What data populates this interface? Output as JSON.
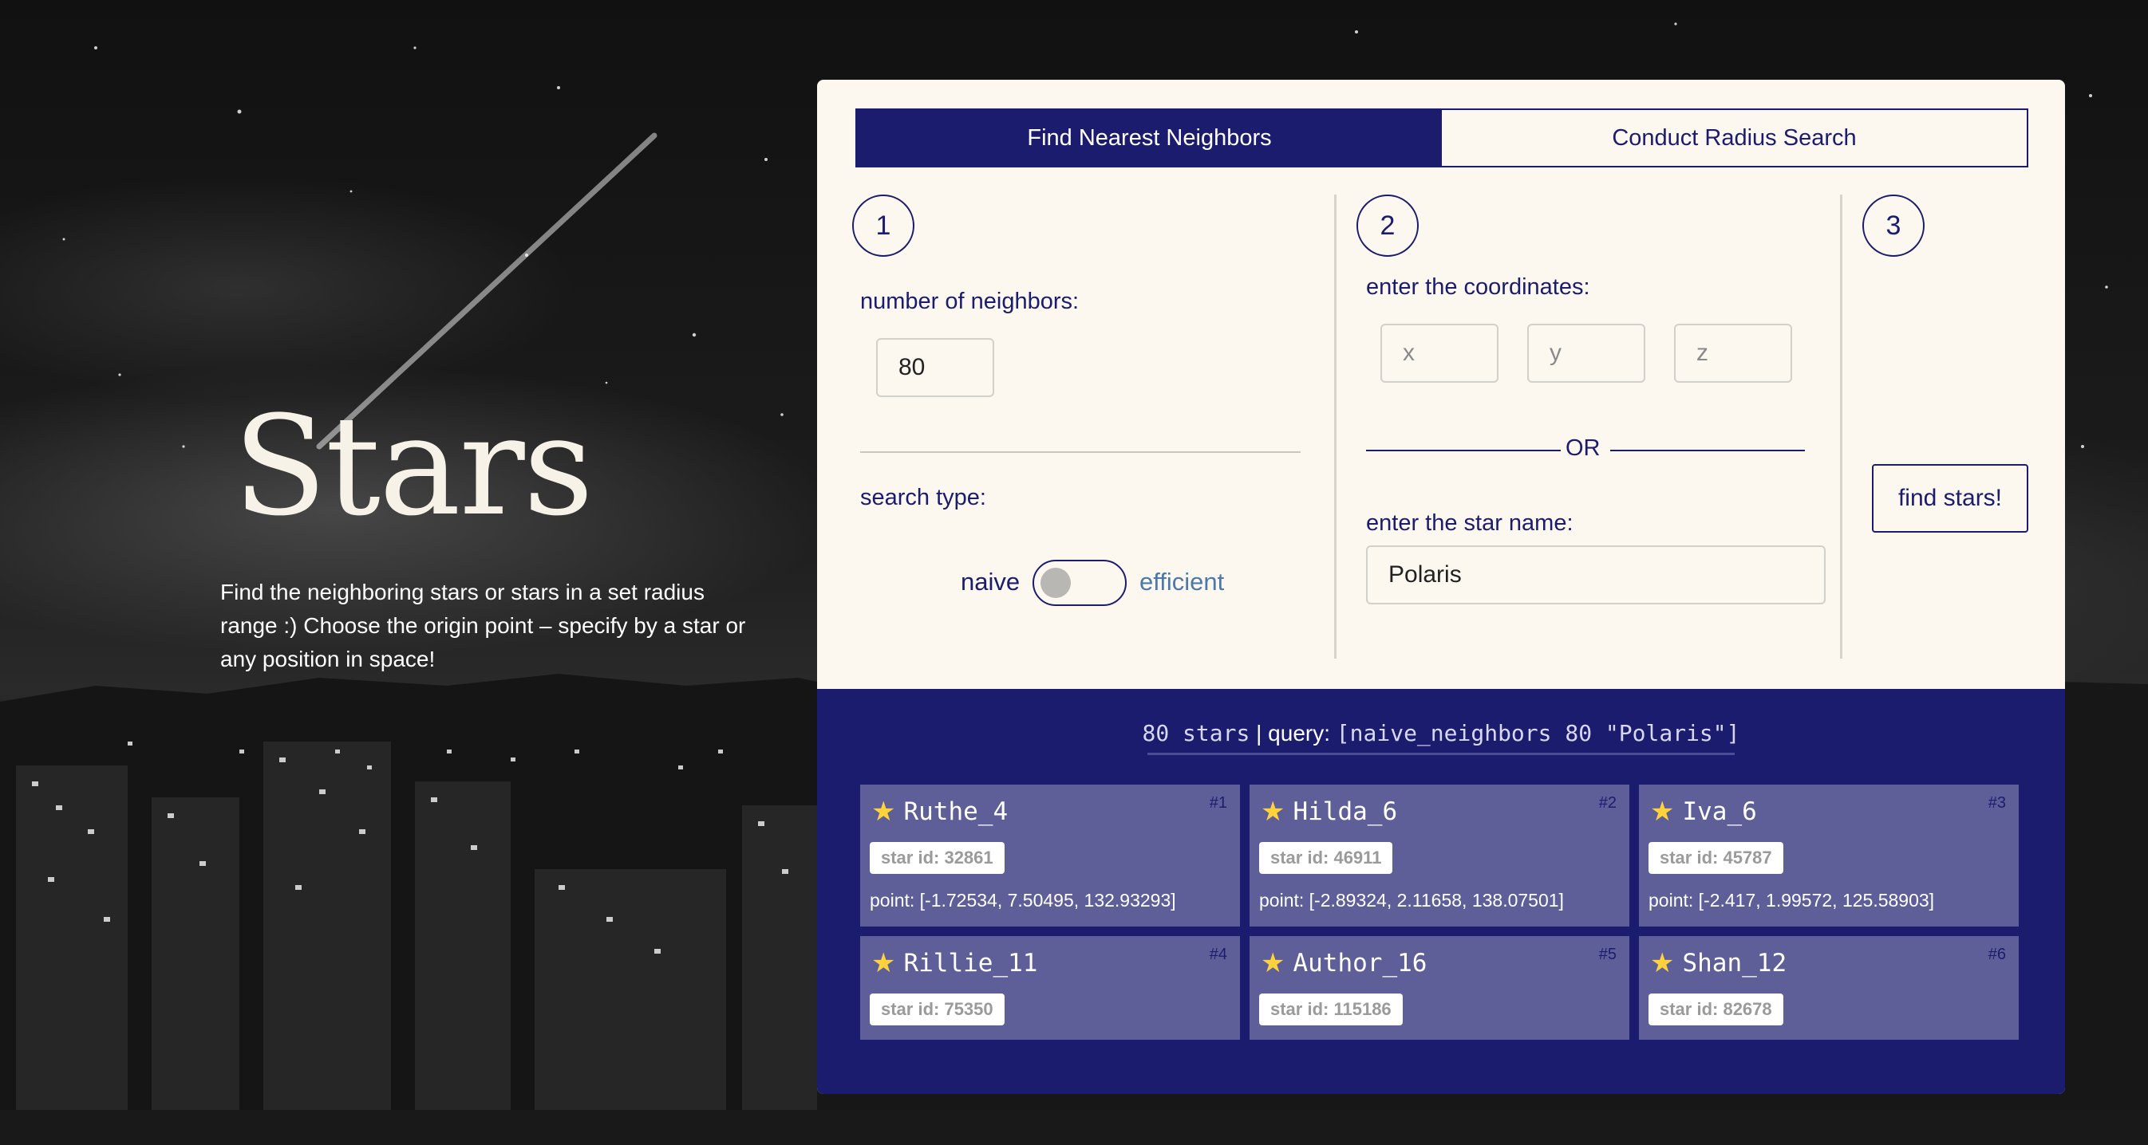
{
  "hero": {
    "title": "Stars",
    "description": "Find the neighboring stars or stars in a set radius range :) Choose the origin point – specify by a star or any position in space!"
  },
  "tabs": [
    {
      "label": "Find Nearest Neighbors",
      "active": true
    },
    {
      "label": "Conduct Radius Search",
      "active": false
    }
  ],
  "steps": {
    "step1": {
      "number": "1",
      "neighbors_label": "number of neighbors:",
      "neighbors_value": "80",
      "search_type_label": "search type:",
      "toggle_left": "naive",
      "toggle_right": "efficient",
      "toggle_on": false
    },
    "step2": {
      "number": "2",
      "coords_label": "enter the coordinates:",
      "x_placeholder": "x",
      "y_placeholder": "y",
      "z_placeholder": "z",
      "or_text": "OR",
      "star_name_label": "enter the star name:",
      "star_name_value": "Polaris"
    },
    "step3": {
      "number": "3",
      "find_button": "find stars!"
    }
  },
  "results": {
    "count_text": "80 stars",
    "separator": "|",
    "query_label": "query:",
    "query_text": "[naive_neighbors 80 \"Polaris\"]",
    "cards": [
      {
        "rank": "#1",
        "name": "Ruthe_4",
        "star_id": "star id: 32861",
        "point": "point: [-1.72534, 7.50495, 132.93293]"
      },
      {
        "rank": "#2",
        "name": "Hilda_6",
        "star_id": "star id: 46911",
        "point": "point: [-2.89324, 2.11658, 138.07501]"
      },
      {
        "rank": "#3",
        "name": "Iva_6",
        "star_id": "star id: 45787",
        "point": "point: [-2.417, 1.99572, 125.58903]"
      },
      {
        "rank": "#4",
        "name": "Rillie_11",
        "star_id": "star id: 75350",
        "point": ""
      },
      {
        "rank": "#5",
        "name": "Author_16",
        "star_id": "star id: 115186",
        "point": ""
      },
      {
        "rank": "#6",
        "name": "Shan_12",
        "star_id": "star id: 82678",
        "point": ""
      }
    ]
  },
  "colors": {
    "navy": "#1b1c6e",
    "card": "#5e5f99",
    "panel": "#fcf8f0",
    "efficient_label": "#4d79a8",
    "star": "#ffd23c"
  },
  "icons": {
    "card_icon": "star-icon"
  }
}
